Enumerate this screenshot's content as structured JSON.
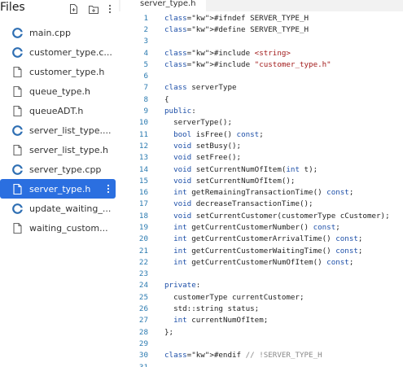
{
  "sidebar": {
    "title": "Files",
    "header_icons": [
      "new-file-icon",
      "new-folder-icon",
      "more-vertical-icon"
    ],
    "files": [
      {
        "name": "main.cpp",
        "icon": "cpp-file-icon",
        "active": false
      },
      {
        "name": "customer_type.c...",
        "icon": "cpp-file-icon",
        "active": false
      },
      {
        "name": "customer_type.h",
        "icon": "file-icon",
        "active": false
      },
      {
        "name": "queue_type.h",
        "icon": "file-icon",
        "active": false
      },
      {
        "name": "queueADT.h",
        "icon": "file-icon",
        "active": false
      },
      {
        "name": "server_list_type....",
        "icon": "cpp-file-icon",
        "active": false
      },
      {
        "name": "server_list_type.h",
        "icon": "file-icon",
        "active": false
      },
      {
        "name": "server_type.cpp",
        "icon": "cpp-file-icon",
        "active": false
      },
      {
        "name": "server_type.h",
        "icon": "file-icon",
        "active": true
      },
      {
        "name": "update_waiting_...",
        "icon": "cpp-file-icon",
        "active": false
      },
      {
        "name": "waiting_custom...",
        "icon": "file-icon",
        "active": false
      }
    ]
  },
  "editor": {
    "tab": {
      "name": "server_type.h"
    },
    "lines": [
      {
        "n": "1",
        "code": "#ifndef SERVER_TYPE_H"
      },
      {
        "n": "2",
        "code": "#define SERVER_TYPE_H"
      },
      {
        "n": "3",
        "code": ""
      },
      {
        "n": "4",
        "code": "#include <string>"
      },
      {
        "n": "5",
        "code": "#include \"customer_type.h\""
      },
      {
        "n": "6",
        "code": ""
      },
      {
        "n": "7",
        "code": "class serverType"
      },
      {
        "n": "8",
        "code": "{"
      },
      {
        "n": "9",
        "code": "public:"
      },
      {
        "n": "10",
        "code": "  serverType();"
      },
      {
        "n": "11",
        "code": "  bool isFree() const;"
      },
      {
        "n": "12",
        "code": "  void setBusy();"
      },
      {
        "n": "13",
        "code": "  void setFree();"
      },
      {
        "n": "14",
        "code": "  void setCurrentNumOfItem(int t);"
      },
      {
        "n": "15",
        "code": "  void setCurrentNumOfItem();"
      },
      {
        "n": "16",
        "code": "  int getRemainingTransactionTime() const;"
      },
      {
        "n": "17",
        "code": "  void decreaseTransactionTime();"
      },
      {
        "n": "18",
        "code": "  void setCurrentCustomer(customerType cCustomer);"
      },
      {
        "n": "19",
        "code": "  int getCurrentCustomerNumber() const;"
      },
      {
        "n": "20",
        "code": "  int getCurrentCustomerArrivalTime() const;"
      },
      {
        "n": "21",
        "code": "  int getCurrentCustomerWaitingTime() const;"
      },
      {
        "n": "22",
        "code": "  int getCurrentCustomerNumOfItem() const;"
      },
      {
        "n": "23",
        "code": ""
      },
      {
        "n": "24",
        "code": "private:"
      },
      {
        "n": "25",
        "code": "  customerType currentCustomer;"
      },
      {
        "n": "26",
        "code": "  std::string status;"
      },
      {
        "n": "27",
        "code": "  int currentNumOfItem;"
      },
      {
        "n": "28",
        "code": "};"
      },
      {
        "n": "29",
        "code": ""
      },
      {
        "n": "30",
        "code": "#endif // !SERVER_TYPE_H"
      },
      {
        "n": "31",
        "code": ""
      }
    ]
  },
  "colors": {
    "active_item": "#2b6fe0",
    "line_number": "#2a7ab0",
    "keyword": "#1d4fa8",
    "string": "#a21b1b",
    "comment": "#8a8a8a",
    "cpp_icon": "#2f6fb3"
  }
}
